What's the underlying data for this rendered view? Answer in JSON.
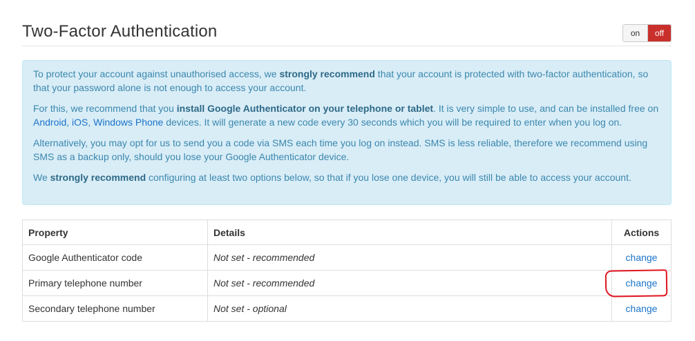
{
  "header": {
    "title": "Two-Factor Authentication",
    "toggle": {
      "on_label": "on",
      "off_label": "off",
      "active": "off",
      "active_color": "#c9302c"
    }
  },
  "alert": {
    "p1": {
      "a": "To protect your account against unauthorised access, we ",
      "b": "strongly recommend",
      "c": " that your account is protected with two-factor authentication, so that your password alone is not enough to access your account."
    },
    "p2": {
      "a": "For this, we recommend that you ",
      "b": "install Google Authenticator on your telephone or tablet",
      "c": ". It is very simple to use, and can be installed free on ",
      "link_android": "Android",
      "sep1": ", ",
      "link_ios": "iOS",
      "sep2": ", ",
      "link_windows": "Windows Phone",
      "d": " devices. It will generate a new code every 30 seconds which you will be required to enter when you log on."
    },
    "p3": "Alternatively, you may opt for us to send you a code via SMS each time you log on instead. SMS is less reliable, therefore we recommend using SMS as a backup only, should you lose your Google Authenticator device.",
    "p4": {
      "a": "We ",
      "b": "strongly recommend",
      "c": " configuring at least two options below, so that if you lose one device, you will still be able to access your account."
    }
  },
  "table": {
    "headers": {
      "property": "Property",
      "details": "Details",
      "actions": "Actions"
    },
    "rows": [
      {
        "property": "Google Authenticator code",
        "details": "Not set - recommended",
        "action": "change"
      },
      {
        "property": "Primary telephone number",
        "details": "Not set - recommended",
        "action": "change"
      },
      {
        "property": "Secondary telephone number",
        "details": "Not set - optional",
        "action": "change"
      }
    ]
  },
  "annotation": {
    "highlight_color": "#e0141e"
  }
}
